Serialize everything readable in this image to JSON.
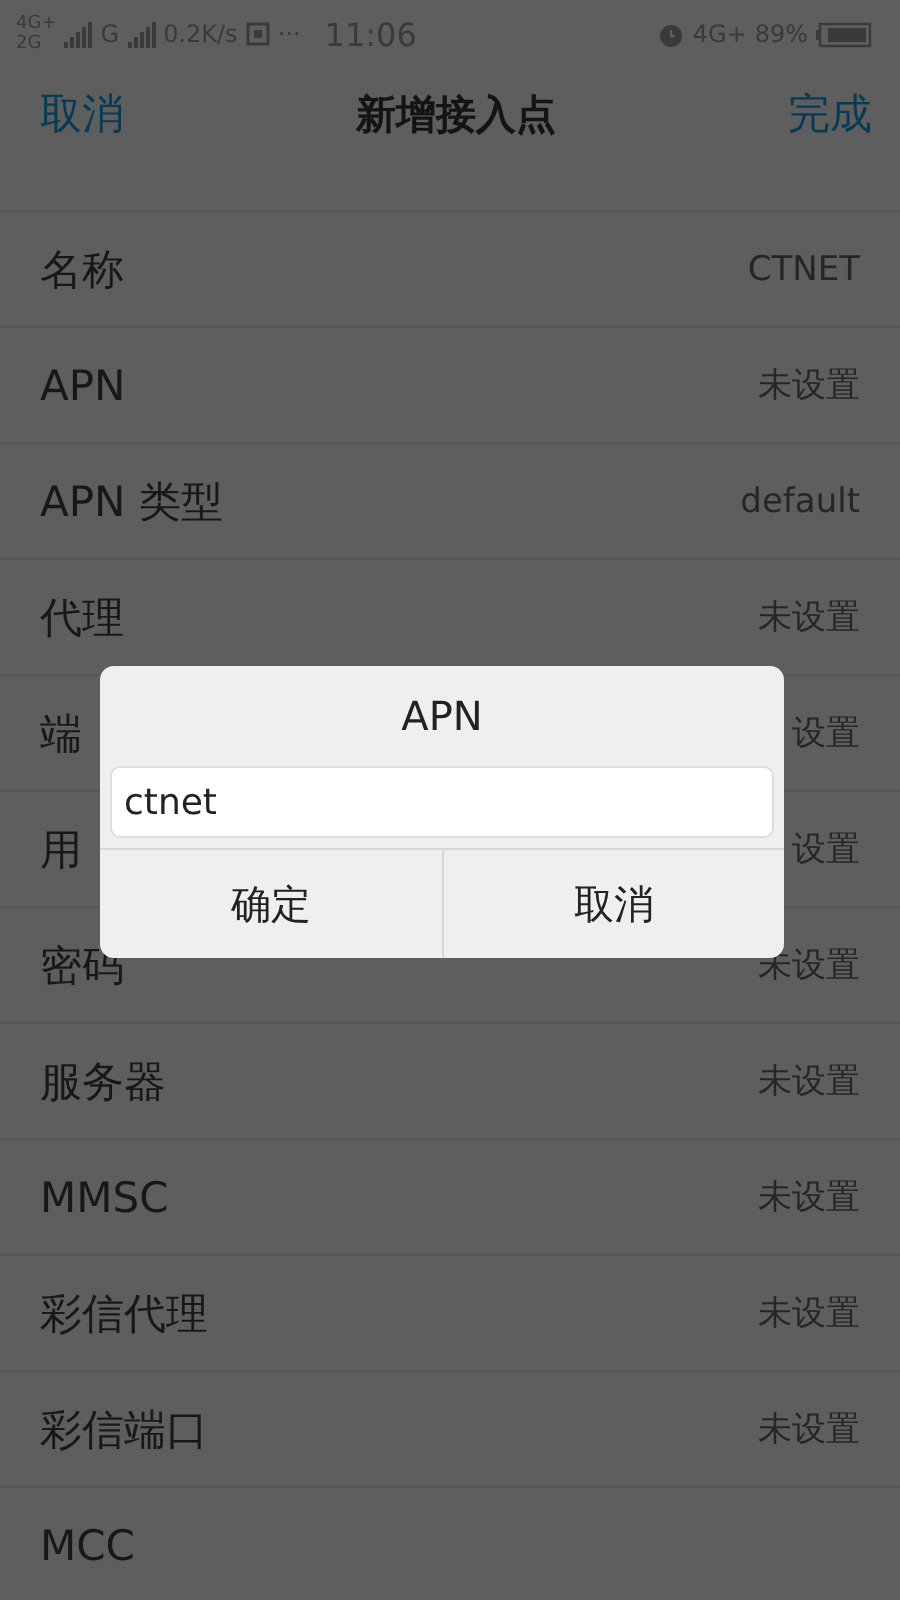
{
  "status_bar": {
    "network_1": "4G+",
    "network_2": "2G",
    "network_3": "G",
    "speed": "0.2K/s",
    "more": "···",
    "time": "11:06",
    "network_4": "4G+",
    "battery": "89%"
  },
  "header": {
    "cancel": "取消",
    "title": "新增接入点",
    "done": "完成"
  },
  "fields": [
    {
      "label": "名称",
      "value": "CTNET"
    },
    {
      "label": "APN",
      "value": "未设置"
    },
    {
      "label": "APN 类型",
      "value": "default"
    },
    {
      "label": "代理",
      "value": "未设置"
    },
    {
      "label": "端",
      "value": "设置"
    },
    {
      "label": "用",
      "value": "设置"
    },
    {
      "label": "密码",
      "value": "未设置"
    },
    {
      "label": "服务器",
      "value": "未设置"
    },
    {
      "label": "MMSC",
      "value": "未设置"
    },
    {
      "label": "彩信代理",
      "value": "未设置"
    },
    {
      "label": "彩信端口",
      "value": "未设置"
    },
    {
      "label": "MCC"
    }
  ],
  "dialog": {
    "title": "APN",
    "input": {
      "value": "ctnet"
    },
    "buttons": [
      "确定",
      "取消"
    ]
  }
}
